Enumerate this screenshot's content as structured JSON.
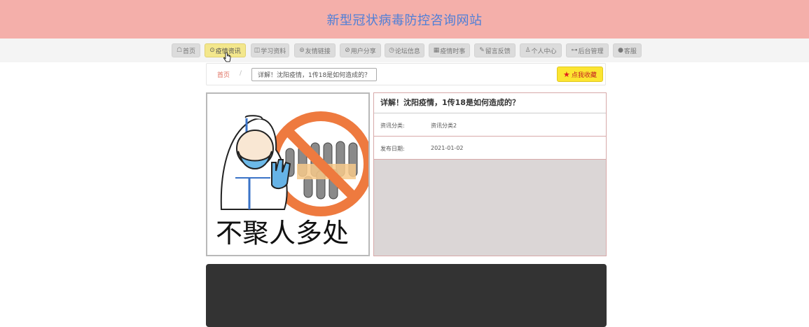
{
  "site": {
    "title": "新型冠状病毒防控咨询网站"
  },
  "nav": {
    "items": [
      {
        "icon": "☖",
        "label": "首页"
      },
      {
        "icon": "⊙",
        "label": "疫情资讯"
      },
      {
        "icon": "◫",
        "label": "学习资料"
      },
      {
        "icon": "⊚",
        "label": "友情链接"
      },
      {
        "icon": "⊘",
        "label": "用户分享"
      },
      {
        "icon": "◷",
        "label": "论坛信息"
      },
      {
        "icon": "▦",
        "label": "疫情时事"
      },
      {
        "icon": "✎",
        "label": "留言反馈"
      },
      {
        "icon": "♙",
        "label": "个人中心"
      },
      {
        "icon": "⊶",
        "label": "后台管理"
      },
      {
        "icon": "●",
        "label": "客服"
      }
    ],
    "active_index": 1
  },
  "breadcrumb": {
    "home": "首页",
    "separator": "/",
    "current": "详解！沈阳疫情，1传18是如何造成的？"
  },
  "favorite_button": {
    "label": "点我收藏"
  },
  "image": {
    "caption": "不聚人多处"
  },
  "detail": {
    "title": "详解！沈阳疫情，1传18是如何造成的？",
    "rows": [
      {
        "label": "资讯分类:",
        "value": "资讯分类2"
      },
      {
        "label": "发布日期:",
        "value": "2021-01-02"
      }
    ]
  },
  "colors": {
    "header_bg": "#f4afaa",
    "title_color": "#4f7fd7",
    "nav_active": "#f3e78c",
    "favorite_bg": "#fce531"
  }
}
